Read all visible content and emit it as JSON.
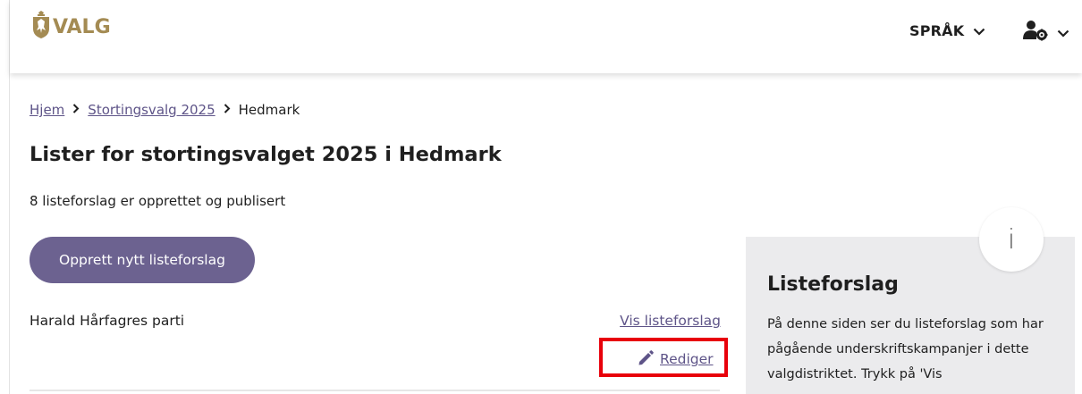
{
  "header": {
    "logo_text": "VALG",
    "language_label": "SPRÅK",
    "icons": [
      "coat-of-arms-icon",
      "chevron-down-icon",
      "user-settings-icon"
    ]
  },
  "breadcrumb": {
    "home": "Hjem",
    "election": "Stortingsvalg 2025",
    "current": "Hedmark"
  },
  "main": {
    "title": "Lister for stortingsvalget 2025 i Hedmark",
    "status_text": "8 listeforslag er opprettet og publisert",
    "create_button_label": "Opprett nytt listeforslag",
    "lists": [
      {
        "party_name": "Harald Hårfagres parti",
        "view_label": "Vis listeforslag",
        "edit_label": "Rediger"
      }
    ]
  },
  "info_panel": {
    "icon_glyph": "i",
    "title": "Listeforslag",
    "text": "På denne siden ser du listeforslag som har pågående underskriftskampanjer i dette valgdistriktet. Trykk på 'Vis"
  },
  "colors": {
    "accent": "#6c6290",
    "link": "#5e5488",
    "logo": "#a48b53",
    "highlight": "#e8000b",
    "panel_bg": "#ebebed"
  }
}
